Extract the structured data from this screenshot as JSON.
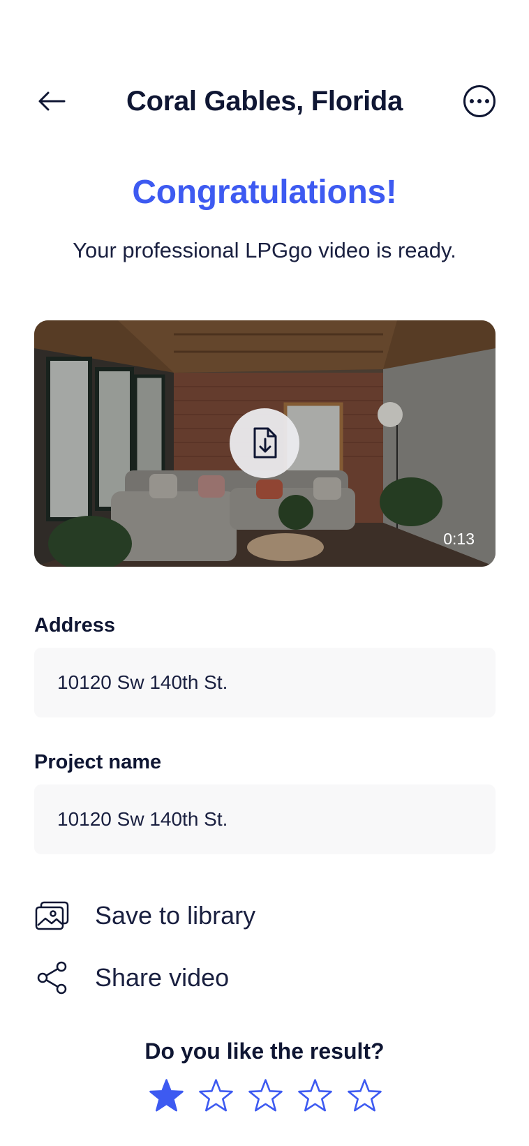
{
  "header": {
    "back_icon": "arrow-left-icon",
    "title": "Coral Gables, Florida",
    "more_icon": "more-horizontal-icon"
  },
  "hero": {
    "heading": "Congratulations!",
    "subtitle": "Your professional LPGgo video is ready."
  },
  "video": {
    "download_icon": "file-download-icon",
    "duration": "0:13"
  },
  "address": {
    "label": "Address",
    "value": "10120 Sw 140th St."
  },
  "project_name": {
    "label": "Project name",
    "value": "10120 Sw 140th St."
  },
  "actions": {
    "save": {
      "icon": "image-library-icon",
      "label": "Save to library"
    },
    "share": {
      "icon": "share-icon",
      "label": "Share video"
    }
  },
  "rating": {
    "question": "Do you like the result?",
    "max": 5,
    "value": 1
  },
  "colors": {
    "accent": "#3d5af1",
    "text_dark": "#0f1633",
    "field_bg": "#f8f8f9"
  }
}
